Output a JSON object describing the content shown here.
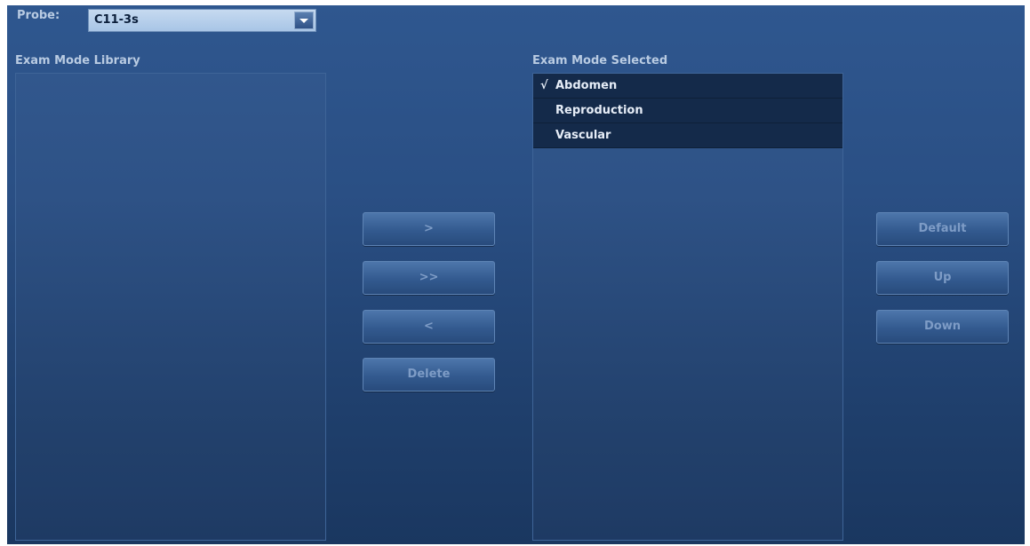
{
  "probe": {
    "label": "Probe:",
    "value": "C11-3s"
  },
  "library": {
    "title": "Exam Mode Library",
    "items": []
  },
  "selected": {
    "title": "Exam Mode Selected",
    "items": [
      {
        "check": "√",
        "label": "Abdomen"
      },
      {
        "check": "",
        "label": "Reproduction"
      },
      {
        "check": "",
        "label": "Vascular"
      }
    ]
  },
  "transfer_buttons": {
    "add": ">",
    "add_all": ">>",
    "remove": "<",
    "delete": "Delete"
  },
  "order_buttons": {
    "default": "Default",
    "up": "Up",
    "down": "Down"
  }
}
